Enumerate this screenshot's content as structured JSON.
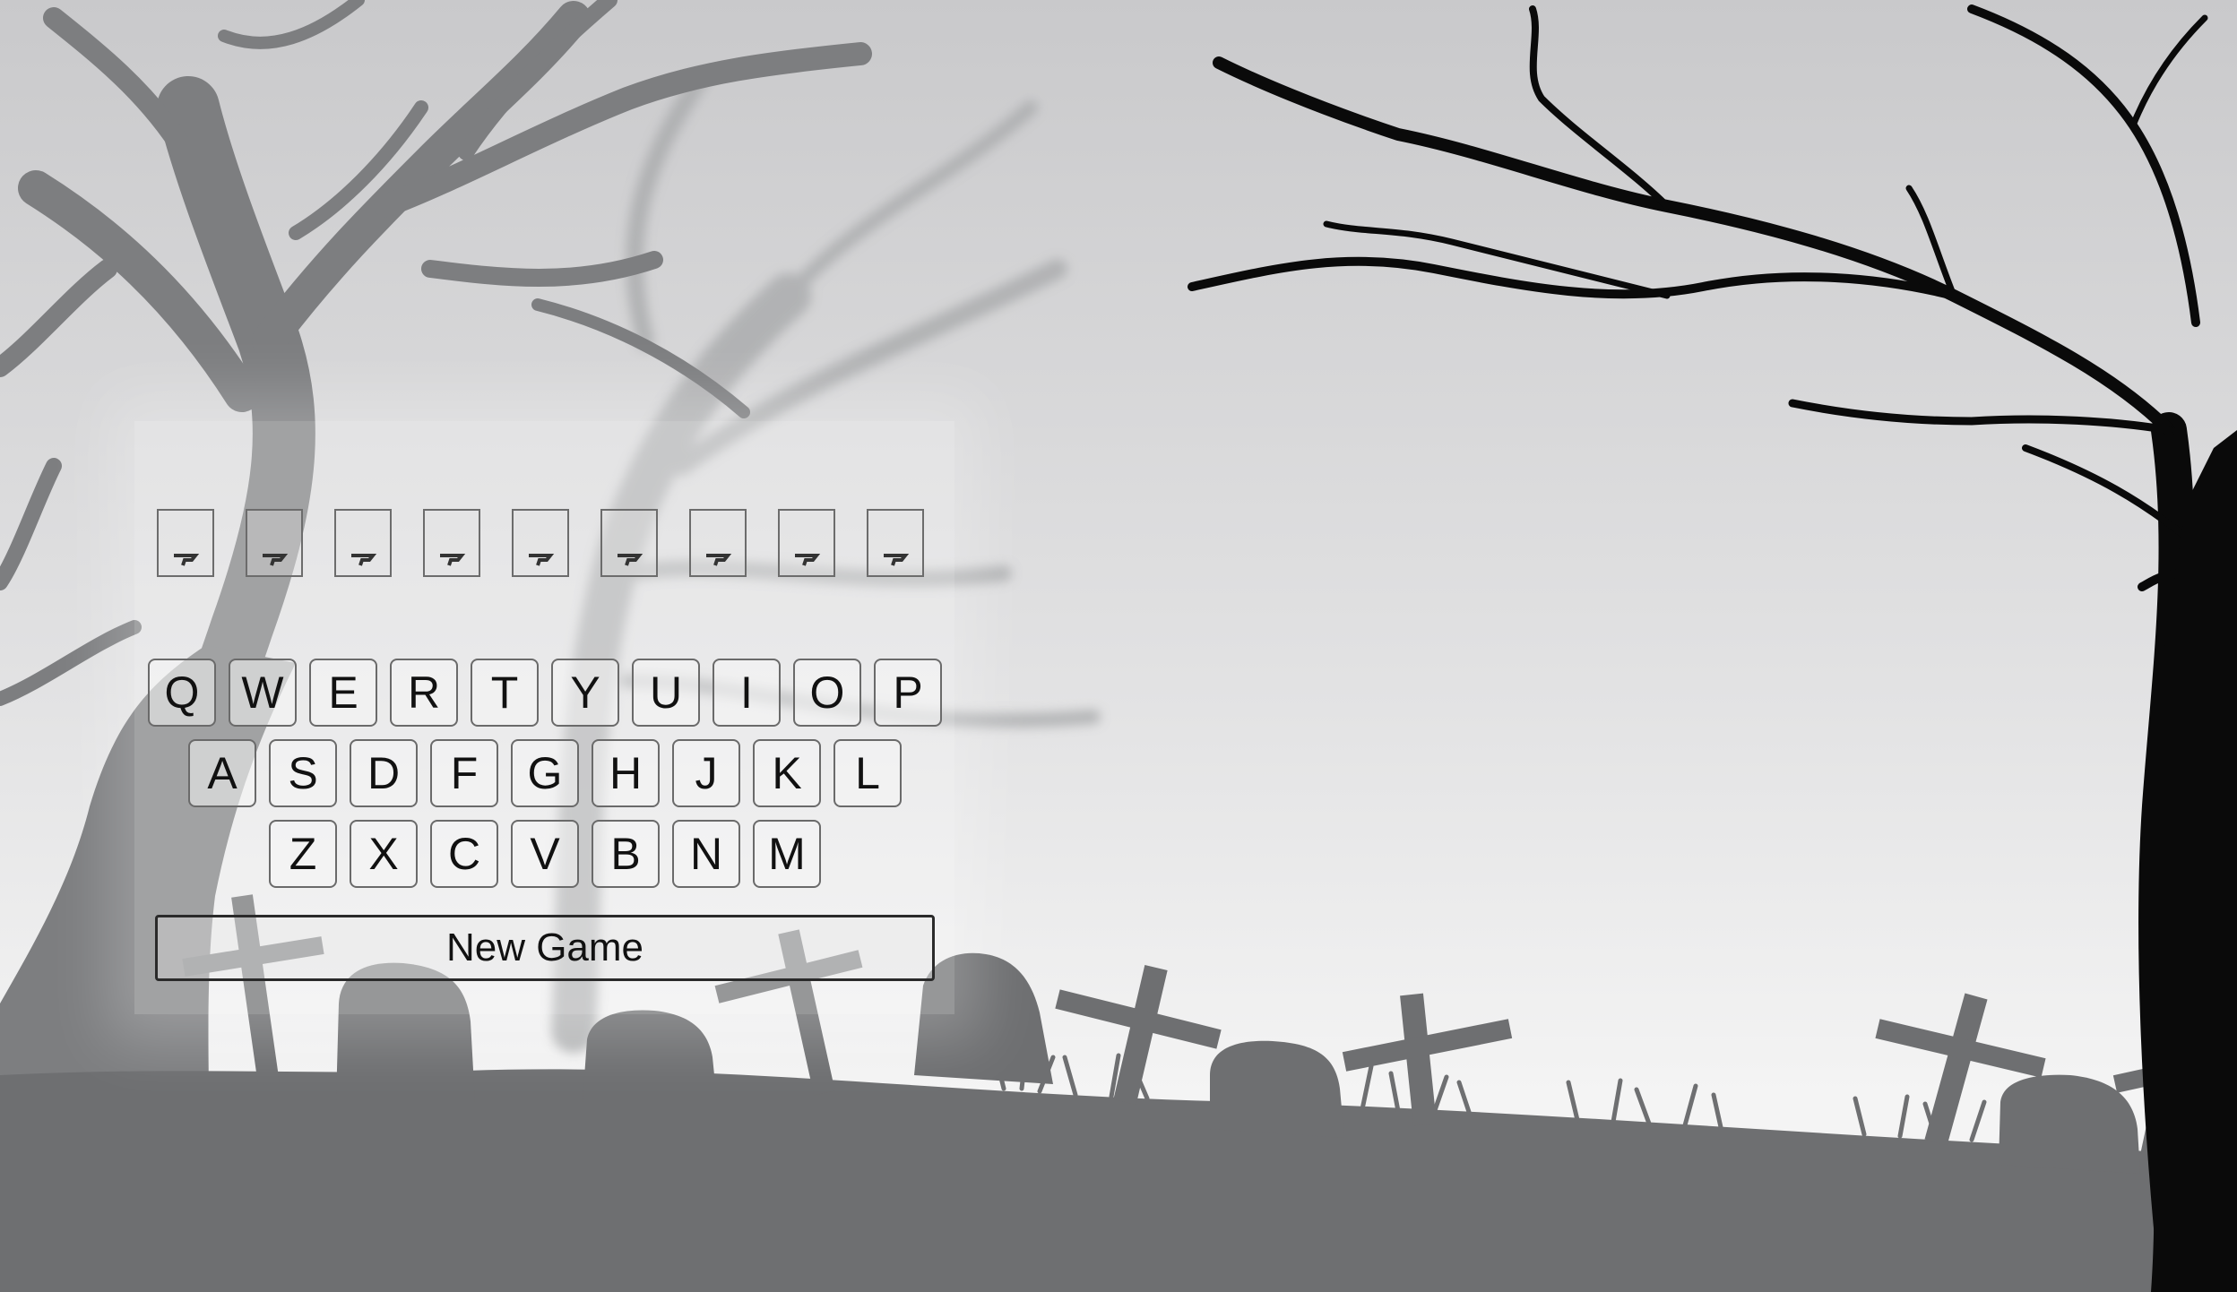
{
  "word_slots": [
    "",
    "",
    "",
    "",
    "",
    "",
    "",
    "",
    ""
  ],
  "keyboard": {
    "row1": [
      "Q",
      "W",
      "E",
      "R",
      "T",
      "Y",
      "U",
      "I",
      "O",
      "P"
    ],
    "row2": [
      "A",
      "S",
      "D",
      "F",
      "G",
      "H",
      "J",
      "K",
      "L"
    ],
    "row3": [
      "Z",
      "X",
      "C",
      "V",
      "B",
      "N",
      "M"
    ]
  },
  "new_game_label": "New Game",
  "colors": {
    "sky_top": "#c9c9cb",
    "sky_bottom": "#f2f2f2",
    "ground": "#6e6f71",
    "tree_left": "#7d7e80",
    "tree_right": "#0a0a0a"
  },
  "background_icons": [
    "dead-tree-icon",
    "cross-icon",
    "tombstone-icon"
  ]
}
